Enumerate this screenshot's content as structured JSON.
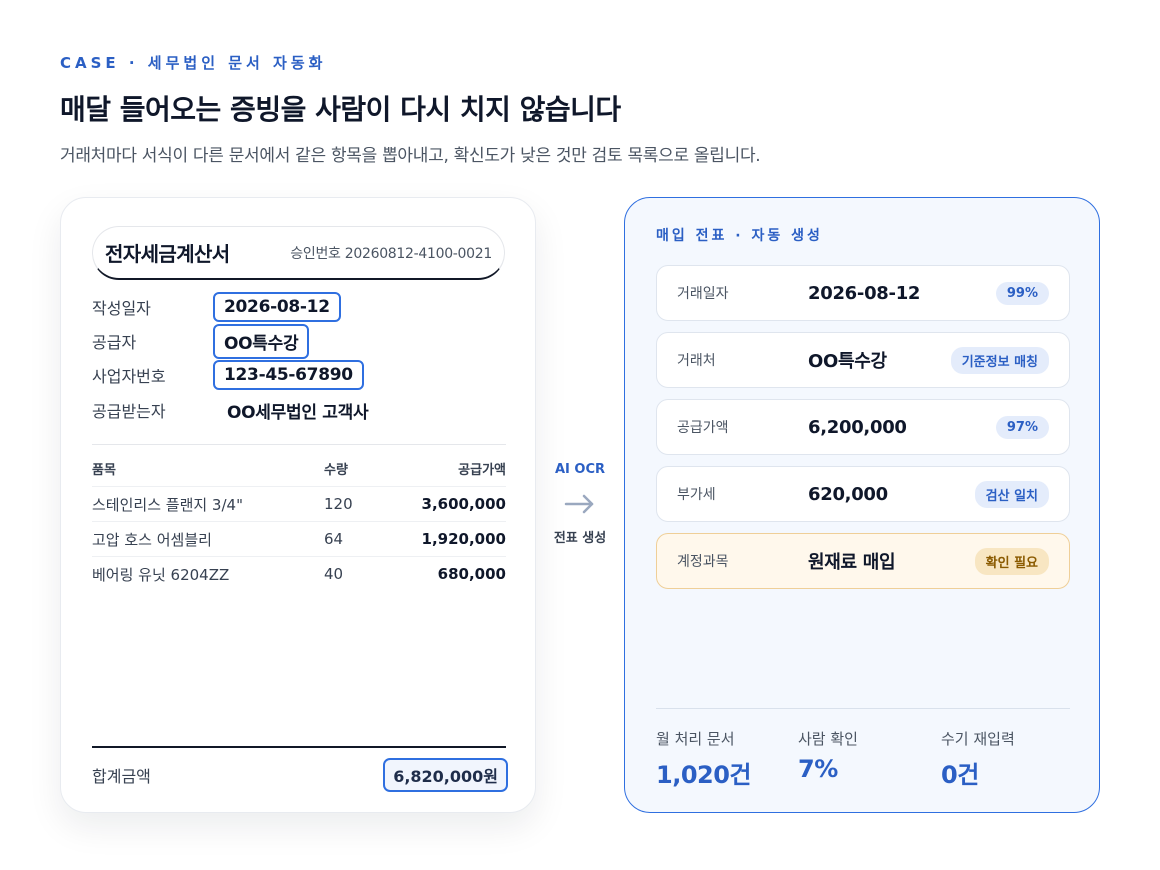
{
  "header": {
    "eyebrow": "CASE · 세무법인 문서 자동화",
    "title": "매달 들어오는 증빙을 사람이 다시 치지 않습니다",
    "subtitle": "거래처마다 서식이 다른 문서에서 같은 항목을 뽑아내고, 확신도가 낮은 것만 검토 목록으로 올립니다."
  },
  "invoice": {
    "title": "전자세금계산서",
    "approval": "승인번호 20260812-4100-0021",
    "fields": [
      {
        "label": "작성일자",
        "value": "2026-08-12",
        "highlighted": true
      },
      {
        "label": "공급자",
        "value": "OO특수강",
        "highlighted": true
      },
      {
        "label": "사업자번호",
        "value": "123-45-67890",
        "highlighted": true
      },
      {
        "label": "공급받는자",
        "value": "OO세무법인 고객사",
        "highlighted": false
      }
    ],
    "columns": {
      "name": "품목",
      "qty": "수량",
      "amount": "공급가액"
    },
    "items": [
      {
        "name": "스테인리스 플랜지 3/4\"",
        "qty": "120",
        "amount": "3,600,000"
      },
      {
        "name": "고압 호스 어셈블리",
        "qty": "64",
        "amount": "1,920,000"
      },
      {
        "name": "베어링 유닛 6204ZZ",
        "qty": "40",
        "amount": "680,000"
      }
    ],
    "total_label": "합계금액",
    "total_value": "6,820,000원"
  },
  "flow": {
    "top_label": "AI OCR",
    "icon": "arrow-right-icon",
    "bottom_label": "전표 생성"
  },
  "voucher": {
    "title": "매입 전표 · 자동 생성",
    "entries": [
      {
        "label": "거래일자",
        "value": "2026-08-12",
        "badge": "99%",
        "status": "ok"
      },
      {
        "label": "거래처",
        "value": "OO특수강",
        "badge": "기준정보 매칭",
        "status": "ok"
      },
      {
        "label": "공급가액",
        "value": "6,200,000",
        "badge": "97%",
        "status": "ok"
      },
      {
        "label": "부가세",
        "value": "620,000",
        "badge": "검산 일치",
        "status": "ok"
      },
      {
        "label": "계정과목",
        "value": "원재료 매입",
        "badge": "확인 필요",
        "status": "warn"
      }
    ],
    "stats": [
      {
        "label": "월 처리 문서",
        "value": "1,020건"
      },
      {
        "label": "사람 확인",
        "value": "7%"
      },
      {
        "label": "수기 재입력",
        "value": "0건"
      }
    ]
  },
  "colors": {
    "accent": "#2b5fc4",
    "highlight_border": "#2f6fe0",
    "warn_bg": "#fff8ec",
    "warn_text": "#8a5a00"
  }
}
